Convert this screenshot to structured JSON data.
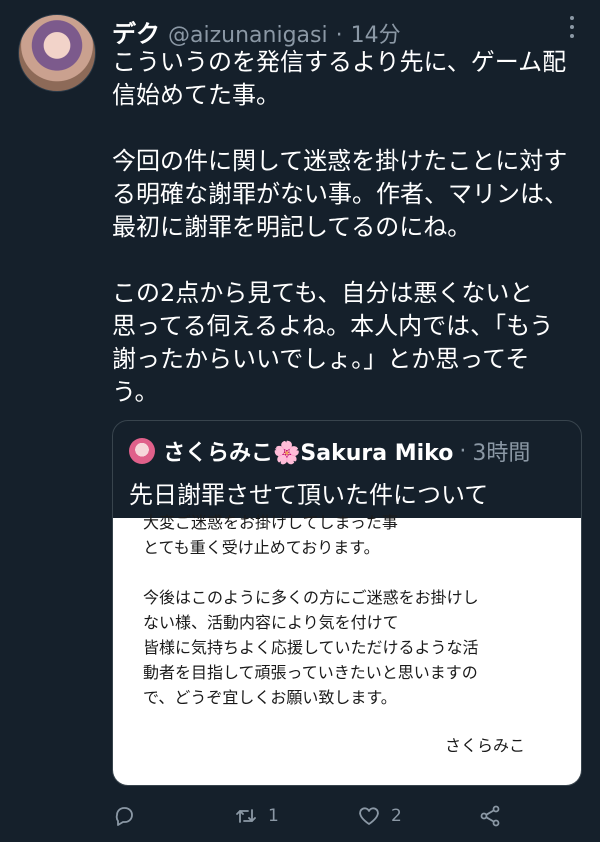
{
  "tweet": {
    "display_name": "デク",
    "handle": "@aizunanigasi",
    "separator": "·",
    "time": "14分",
    "text": "こういうのを発信するより先に、ゲーム配\n信始めてた事。\n\n今回の件に関して迷惑を掛けたことに対す\nる明確な謝罪がない事。作者、マリンは、\n最初に謝罪を明記してるのにね。\n\nこの2点から見ても、自分は悪くないと\n思ってる伺えるよね。本人内では、「もう\n謝ったからいいでしょ。」とか思ってそ\nう。"
  },
  "quote": {
    "display_name": "さくらみこ🌸Sakura Miko",
    "separator": "·",
    "time": "3時間",
    "text": "先日謝罪させて頂いた件について",
    "image_text": "大変ご迷惑をお掛けしてしまった事\nとても重く受け止めております。\n\n今後はこのように多くの方にご迷惑をお掛けし\nない様、活動内容により気を付けて\n皆様に気持ちよく応援していただけるような活\n動者を目指して頑張っていきたいと思いますの\nで、どうぞ宜しくお願い致します。",
    "image_signature": "さくらみこ"
  },
  "actions": {
    "reply_icon": "reply-icon",
    "retweet_icon": "retweet-icon",
    "retweet_count": "1",
    "like_icon": "heart-icon",
    "like_count": "2",
    "share_icon": "share-icon"
  },
  "colors": {
    "background": "#15202b",
    "text": "#ffffff",
    "muted": "#8b98a5",
    "border": "#38444d"
  }
}
